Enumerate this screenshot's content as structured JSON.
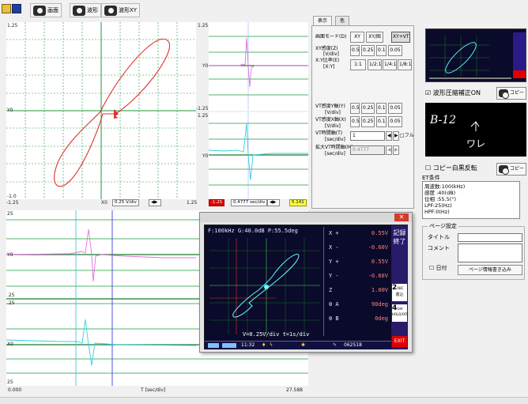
{
  "toolbar": {
    "btn_screen": "画面",
    "btn_wave": "波形",
    "btn_wave_xy": "波形XY"
  },
  "xy_plot": {
    "y_top": "1.25",
    "y_mid": "Y0",
    "y_bot": "-1.0",
    "x_left": "-1.25",
    "x_mid": "X0",
    "x_right": "1.25",
    "scale_box": "0.25 V/div",
    "right_top": "1.25",
    "right_mid_a": "-1.25",
    "right_mid_b": "1.25",
    "right_y0": "Y0",
    "right_y0b": "Y0",
    "bot_left_val": "-1.25",
    "bot_mid_box": "0.4777 sec/div",
    "bot_right_val": "5.141"
  },
  "time_plot": {
    "y_top": "25",
    "y0a": "Y0",
    "y_mid_a": ".25",
    "y_mid_b": ".25",
    "y0b": "X0",
    "y_bot": "25",
    "x_left": "0.000",
    "x_label": "T [sec/div]",
    "x_right": "27.588"
  },
  "settings": {
    "tab_display": "表示",
    "tab_color": "色",
    "mode_label": "画面モード(D)",
    "mode_xy": "XY",
    "mode_xy_fixed": "XY/固",
    "mode_xyvt": "XY+VT",
    "xy_sens_label": "XY感度(Z)",
    "xy_sens_unit": "[V/div]",
    "sens_values": [
      "0.5",
      "0.25",
      "0.1",
      "0.05"
    ],
    "xy_ratio_label": "X:Y比率(E)",
    "xy_ratio_unit": "[X:Y]",
    "ratio_values": [
      "1:1",
      "1/2:1",
      "1/4:1",
      "1/8:1"
    ],
    "vt_sens_y_label": "VT感度Y軸(Y)",
    "vt_sens_y_unit": "[V/div]",
    "vt_sens_x_label": "VT感度X軸(X)",
    "vt_sens_x_unit": "[V/div]",
    "vt_time_label": "VT時間軸(T)",
    "vt_time_unit": "[sec/div]",
    "vt_time_value": "1",
    "full_label": "フル",
    "vt_time_max_label": "拡大VT時間軸(M)",
    "vt_time_max_unit": "[sec/div]",
    "vt_time_max_value": "0.4777"
  },
  "right": {
    "compress_label": "波形圧縮補正ON",
    "copy_btn": "コピー",
    "handwriting": "B-12",
    "handwriting2": "ワレ",
    "invert_label": "コピー白黒反転",
    "copy_btn2": "コピー",
    "et_label": "ET条件",
    "et_lines": [
      "周波数:100(kHz)",
      "感度 :40(dB)",
      "位相 :55.5(°)",
      "LPF:25(Hz)",
      "HPF:0(Hz)"
    ],
    "page_settings": "ページ設定",
    "title_label": "タイトル",
    "comment_label": "コメント",
    "date_label": "日付",
    "write_btn": "ページ情報書き込み"
  },
  "dialog": {
    "header": "F:100kHz G:40.0dB P:55.5deg",
    "rows": [
      {
        "k": "X +",
        "v": "0.55V"
      },
      {
        "k": "X -",
        "v": "-0.60V"
      },
      {
        "k": "Y +",
        "v": "0.55V"
      },
      {
        "k": "Y -",
        "v": "-0.60V"
      },
      {
        "k": "Z",
        "v": "1.00V"
      },
      {
        "k": "θ A",
        "v": "90deg"
      },
      {
        "k": "θ B",
        "v": "0deg"
      }
    ],
    "side_title": "記録終了",
    "side_b1_num": "2",
    "side_b1_txt": "ABC",
    "side_b1_sub": "書込",
    "side_b2_num": "4",
    "side_b2_txt": "GHI",
    "side_b2_sub": "HOLD/OFF",
    "side_exit": "EXIT",
    "footer": "V=0.25V/div  t=1s/div",
    "status_time": "11:32",
    "status_num": "062518"
  },
  "colors": {
    "grid": "#1a9a3a",
    "xy_trace": "#e03030",
    "y_trace": "#e070e0",
    "x_trace": "#30d0e0",
    "dialog_bg": "#0a0a2a",
    "dialog_side": "#2a1a6a"
  }
}
